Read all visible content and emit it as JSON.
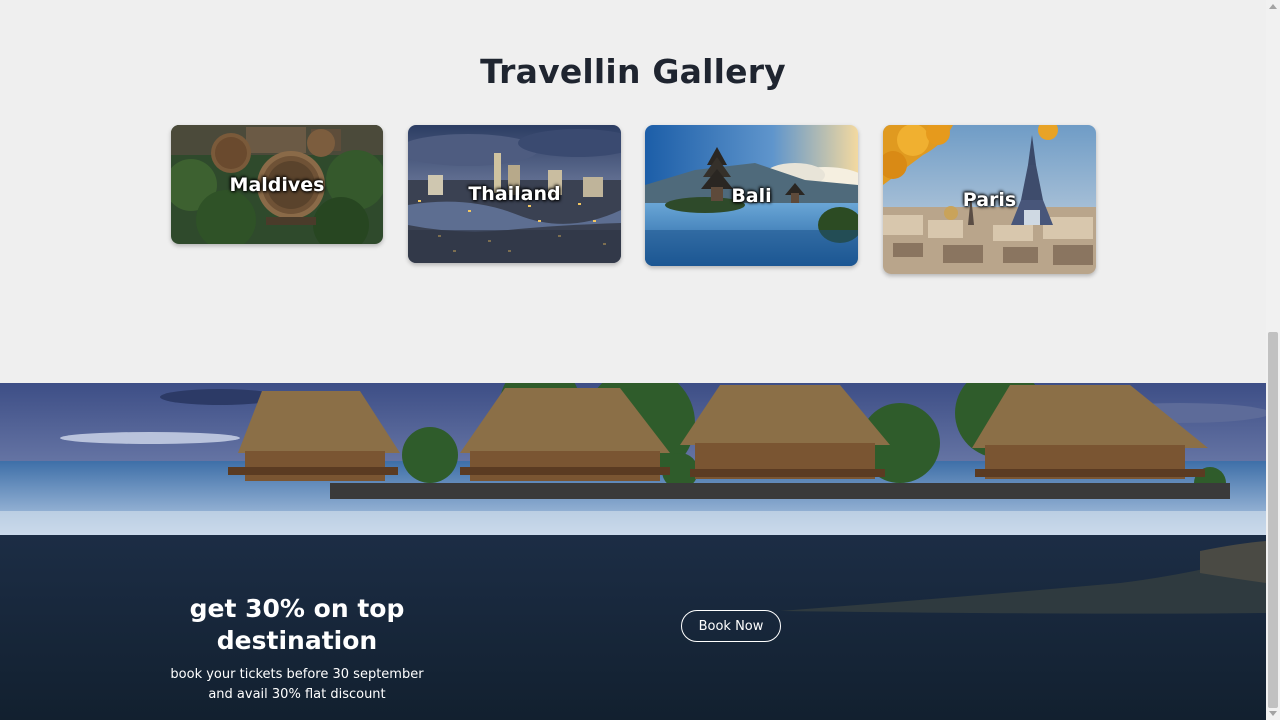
{
  "gallery": {
    "title": "Travellin Gallery",
    "cards": [
      {
        "label": "Maldives"
      },
      {
        "label": "Thailand"
      },
      {
        "label": "Bali"
      },
      {
        "label": "Paris"
      }
    ]
  },
  "promo": {
    "heading": "get 30% on top destination",
    "subtext": "book your tickets before 30 september and avail 30% flat discount",
    "button_label": "Book Now"
  },
  "colors": {
    "page_background": "#efefef",
    "heading_text": "#1f2530",
    "promo_text": "#ffffff"
  },
  "icons": [
    "scroll-up-arrow-icon",
    "scroll-down-arrow-icon"
  ]
}
